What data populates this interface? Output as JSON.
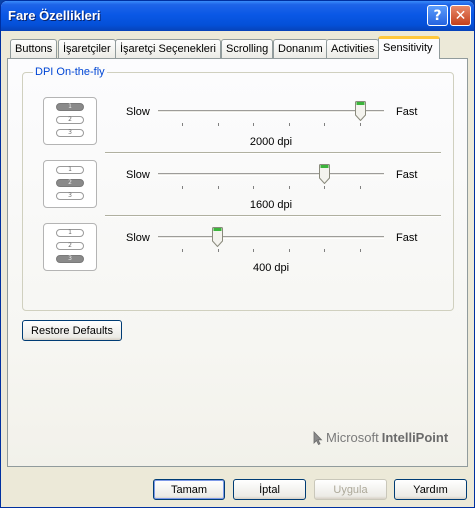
{
  "window": {
    "title": "Fare Özellikleri",
    "help_glyph": "?",
    "close_glyph": "✕"
  },
  "tabs": [
    {
      "label": "Buttons",
      "active": false
    },
    {
      "label": "İşaretçiler",
      "active": false
    },
    {
      "label": "İşaretçi Seçenekleri",
      "active": false
    },
    {
      "label": "Scrolling",
      "active": false
    },
    {
      "label": "Donanım",
      "active": false
    },
    {
      "label": "Activities",
      "active": false
    },
    {
      "label": "Sensitivity",
      "active": true
    }
  ],
  "group": {
    "title": "DPI On-the-fly"
  },
  "sliders": [
    {
      "slow_label": "Slow",
      "fast_label": "Fast",
      "value_label": "2000 dpi",
      "selected_level": 1,
      "position_fraction": 1.0
    },
    {
      "slow_label": "Slow",
      "fast_label": "Fast",
      "value_label": "1600 dpi",
      "selected_level": 2,
      "position_fraction": 0.8
    },
    {
      "slow_label": "Slow",
      "fast_label": "Fast",
      "value_label": "400 dpi",
      "selected_level": 3,
      "position_fraction": 0.2
    }
  ],
  "levels": [
    "1",
    "2",
    "3"
  ],
  "restore_defaults_label": "Restore Defaults",
  "branding": {
    "microsoft": "Microsoft",
    "product": "IntelliPoint",
    "icon": "mouse-cursor-icon"
  },
  "footer": {
    "ok_label": "Tamam",
    "cancel_label": "İptal",
    "apply_label": "Uygula",
    "help_label": "Yardım",
    "apply_enabled": false
  },
  "colors": {
    "title_bar": "#0a58e6",
    "active_tab_highlight": "#ffc83c",
    "group_title": "#0046d5",
    "thumb_accent": "#3cb43c"
  }
}
